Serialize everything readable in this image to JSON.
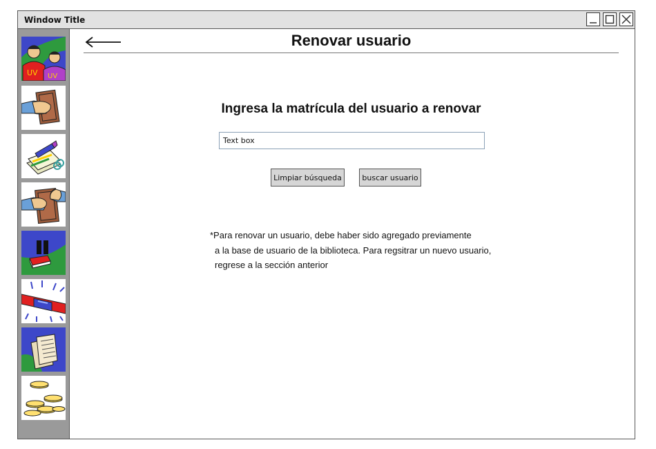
{
  "window": {
    "title": "Window Title"
  },
  "sidebar": {
    "items": [
      {
        "icon": "users-icon"
      },
      {
        "icon": "book-handout-icon"
      },
      {
        "icon": "writing-papers-icon"
      },
      {
        "icon": "book-exchange-icon"
      },
      {
        "icon": "paused-book-icon"
      },
      {
        "icon": "alarm-light-icon"
      },
      {
        "icon": "documents-icon"
      },
      {
        "icon": "coins-icon"
      }
    ]
  },
  "header": {
    "title": "Renovar usuario"
  },
  "main": {
    "prompt": "Ingresa la matrícula del usuario a renovar",
    "search_input": {
      "value": "Text box"
    },
    "clear_button": "Limpiar búsqueda",
    "search_button": "buscar usuario",
    "note": {
      "line1": "*Para renovar un usuario, debe haber sido agregado previamente",
      "line2": "a la base de usuario de la biblioteca. Para regsitrar un nuevo usuario,",
      "line3": "regrese a la sección anterior"
    }
  },
  "colors": {
    "sidebar_bg": "#9a9a9a",
    "titlebar_bg": "#e2e2e2",
    "button_bg": "#d6d6d6",
    "icon_blue": "#3d47c9",
    "icon_green": "#2e9a3e"
  }
}
